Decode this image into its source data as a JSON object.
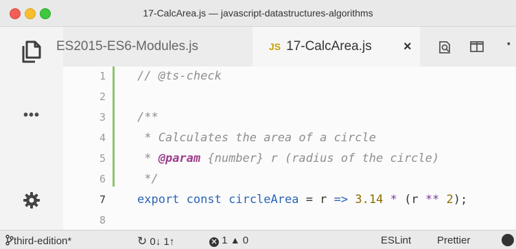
{
  "window": {
    "title": "17-CalcArea.js — javascript-datastructures-algorithms"
  },
  "activity_bar": {
    "explorer_icon": "files-icon",
    "more_icon": "ellipsis-icon",
    "more_glyph": "•••",
    "settings_icon": "gear-icon"
  },
  "tabs": [
    {
      "label": "ES2015-ES6-Modules.js",
      "active": false
    },
    {
      "label": "17-CalcArea.js",
      "active": true,
      "lang_badge": "JS",
      "close_glyph": "×"
    }
  ],
  "tab_actions": {
    "compare_icon": "open-changes-icon",
    "split_icon": "split-editor-icon",
    "more_glyph": "·"
  },
  "editor": {
    "line_numbers": [
      "1",
      "2",
      "3",
      "4",
      "5",
      "6",
      "7",
      "8"
    ],
    "lines": {
      "l1": "// @ts-check",
      "l3": "/**",
      "l4": " * Calculates the area of a circle",
      "l5_prefix": " * ",
      "l5_tag": "@param",
      "l5_rest": " {number} r (radius of the circle)",
      "l6": " */",
      "l7_export": "export",
      "l7_const": "const",
      "l7_name": "circleArea",
      "l7_eq": " = r ",
      "l7_arrow": "=>",
      "l7_num1": "3.14",
      "l7_mul": "*",
      "l7_open": "(r ",
      "l7_pow": "**",
      "l7_num2": "2",
      "l7_close": ");"
    }
  },
  "status_bar": {
    "branch": "third-edition*",
    "sync": "0↓ 1↑",
    "errors": "1",
    "warnings": "0",
    "eslint": "ESLint",
    "prettier": "Prettier"
  },
  "colors": {
    "git_modified_bar": "#8cc36e",
    "js_badge": "#c9a100",
    "keyword": "#2a63b5"
  }
}
